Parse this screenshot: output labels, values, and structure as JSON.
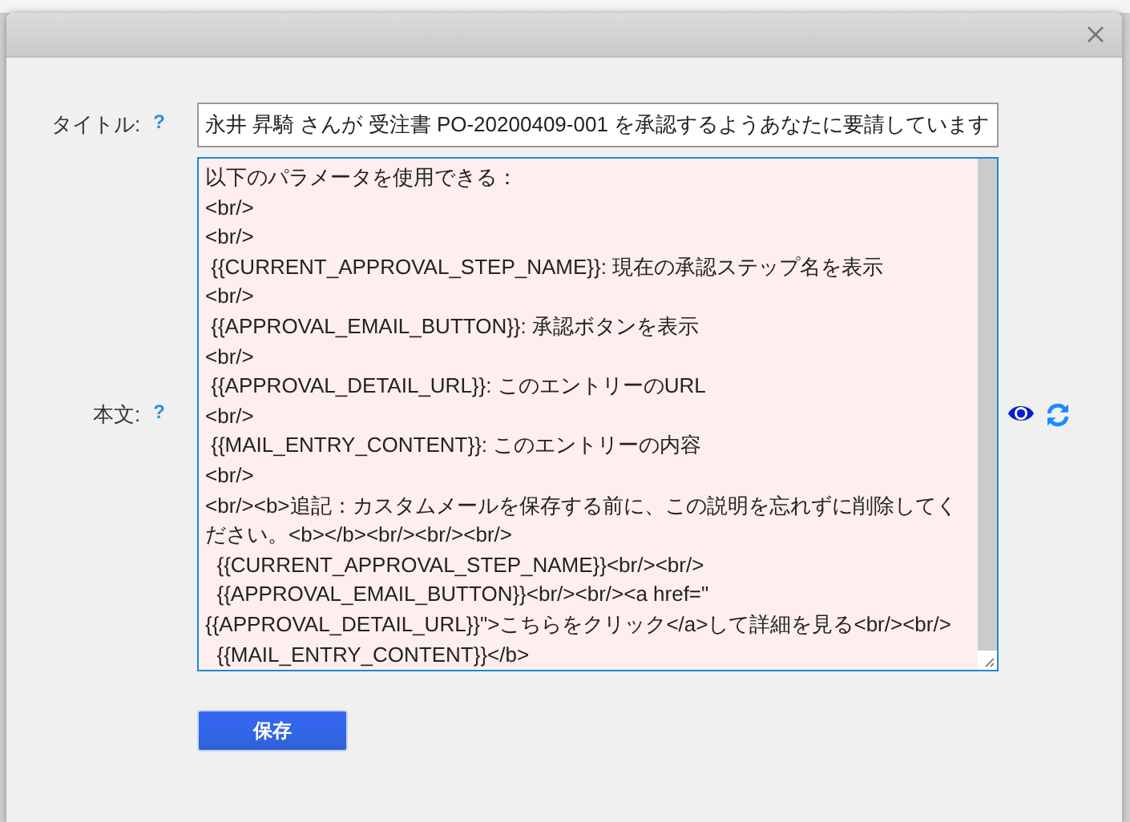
{
  "title_field": {
    "label": "タイトル:",
    "help": "?",
    "value": "永井 昇騎 さんが 受注書 PO-20200409-001 を承認するようあなたに要請しています"
  },
  "body_field": {
    "label": "本文:",
    "help": "?",
    "lines": [
      "以下のパラメータを使用できる：",
      "<br/>",
      "<br/>",
      " {{CURRENT_APPROVAL_STEP_NAME}}: 現在の承認ステップ名を表示",
      "<br/>",
      " {{APPROVAL_EMAIL_BUTTON}}: 承認ボタンを表示",
      "<br/>",
      " {{APPROVAL_DETAIL_URL}}: このエントリーのURL",
      "<br/>",
      " {{MAIL_ENTRY_CONTENT}}: このエントリーの内容",
      "<br/>",
      "<br/><b>追記：カスタムメールを保存する前に、この説明を忘れずに削除してく",
      "ださい。<b></b><br/><br/><br/>",
      "  {{CURRENT_APPROVAL_STEP_NAME}}<br/><br/>",
      "  {{APPROVAL_EMAIL_BUTTON}}<br/><br/><a href=\"",
      "{{APPROVAL_DETAIL_URL}}\">こちらをクリック</a>して詳細を見る<br/><br/>",
      "  {{MAIL_ENTRY_CONTENT}}</b>"
    ]
  },
  "save_button": "保存"
}
